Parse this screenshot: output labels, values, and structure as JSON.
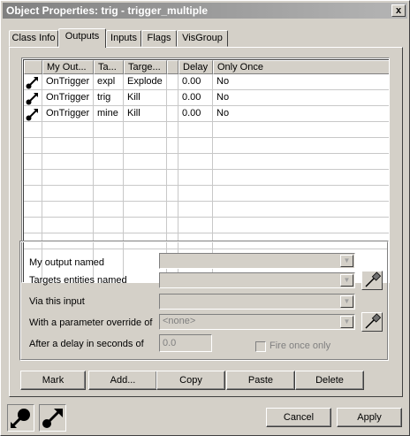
{
  "window": {
    "title": "Object Properties: trig - trigger_multiple",
    "close_glyph": "x"
  },
  "tabs": [
    {
      "label": "Class Info"
    },
    {
      "label": "Outputs"
    },
    {
      "label": "Inputs"
    },
    {
      "label": "Flags"
    },
    {
      "label": "VisGroup"
    }
  ],
  "active_tab": "Outputs",
  "outputs_list": {
    "columns": [
      "",
      "My Out...",
      "Ta...",
      "Targe...",
      "",
      "Delay",
      "Only Once"
    ],
    "rows": [
      {
        "icon": "output-connection-icon",
        "output": "OnTrigger",
        "target": "expl",
        "input": "Explode",
        "param": "",
        "delay": "0.00",
        "only_once": "No"
      },
      {
        "icon": "output-connection-icon",
        "output": "OnTrigger",
        "target": "trig",
        "input": "Kill",
        "param": "",
        "delay": "0.00",
        "only_once": "No"
      },
      {
        "icon": "output-connection-icon",
        "output": "OnTrigger",
        "target": "mine",
        "input": "Kill",
        "param": "",
        "delay": "0.00",
        "only_once": "No"
      }
    ]
  },
  "form": {
    "output_named_label": "My output named",
    "targets_label": "Targets entities named",
    "via_input_label": "Via this input",
    "parameter_label": "With a parameter override of",
    "parameter_value": "<none>",
    "delay_label": "After a delay in seconds of",
    "delay_value": "0.0",
    "fire_once_label": "Fire once only"
  },
  "buttons": {
    "mark": "Mark",
    "add": "Add...",
    "copy": "Copy",
    "paste": "Paste",
    "delete": "Delete",
    "cancel": "Cancel",
    "apply": "Apply"
  },
  "colors": {
    "face": "#d4d0c8",
    "title_gradient_start": "#808080",
    "list_background": "#ffffff",
    "disabled_text": "#808080"
  }
}
